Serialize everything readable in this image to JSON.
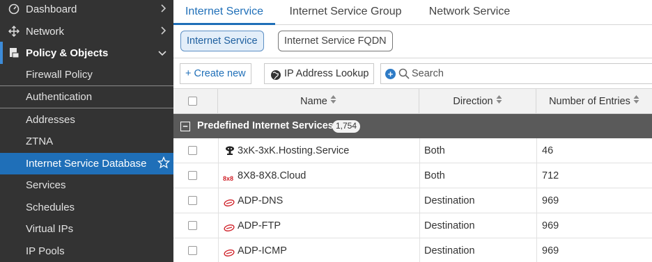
{
  "sidebar": {
    "top_items": [
      {
        "label": "Dashboard",
        "icon": "dashboard-icon"
      },
      {
        "label": "Network",
        "icon": "network-icon"
      },
      {
        "label": "Policy & Objects",
        "icon": "policy-objects-icon"
      }
    ],
    "sub_items": [
      {
        "label": "Firewall Policy"
      },
      {
        "label": "Authentication"
      },
      {
        "label": "Addresses"
      },
      {
        "label": "ZTNA"
      },
      {
        "label": "Internet Service Database"
      },
      {
        "label": "Services"
      },
      {
        "label": "Schedules"
      },
      {
        "label": "Virtual IPs"
      },
      {
        "label": "IP Pools"
      }
    ],
    "selected": "Internet Service Database"
  },
  "tabs": [
    {
      "label": "Internet Service"
    },
    {
      "label": "Internet Service Group"
    },
    {
      "label": "Network Service"
    }
  ],
  "subtabs": [
    {
      "label": "Internet Service"
    },
    {
      "label": "Internet Service FQDN"
    }
  ],
  "toolbar": {
    "create_label": "+ Create new",
    "lookup_label": "IP Address Lookup",
    "search_placeholder": "Search"
  },
  "table": {
    "columns": [
      "Name",
      "Direction",
      "Number of Entries"
    ],
    "group": {
      "title": "Predefined Internet Services",
      "count": "1,754"
    },
    "rows": [
      {
        "name": "3xK-3xK.Hosting.Service",
        "direction": "Both",
        "entries": "46",
        "icon": "hosting-service-icon"
      },
      {
        "name": "8X8-8X8.Cloud",
        "direction": "Both",
        "entries": "712",
        "icon": "8x8-logo-icon"
      },
      {
        "name": "ADP-DNS",
        "direction": "Destination",
        "entries": "969",
        "icon": "adp-logo-icon"
      },
      {
        "name": "ADP-FTP",
        "direction": "Destination",
        "entries": "969",
        "icon": "adp-logo-icon"
      },
      {
        "name": "ADP-ICMP",
        "direction": "Destination",
        "entries": "969",
        "icon": "adp-logo-icon"
      }
    ]
  },
  "colors": {
    "sidebar_bg": "#333333",
    "selected_bg": "#1f6fb8",
    "accent": "#1f6fb8",
    "group_row_bg": "#5a5a5a"
  }
}
